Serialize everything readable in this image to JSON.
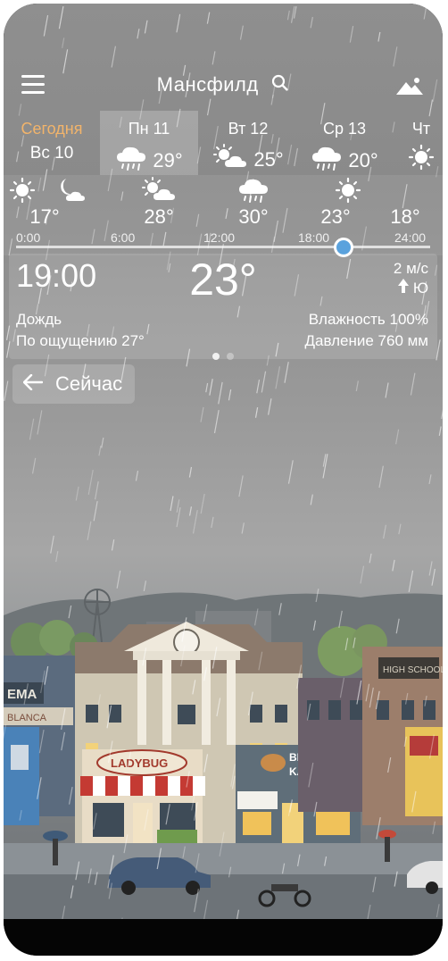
{
  "header": {
    "city": "Мансфилд"
  },
  "days": [
    {
      "name": "Сегодня",
      "date": "Вс 10",
      "today": true
    },
    {
      "name": "Пн 11",
      "temp": "29°",
      "icon": "rain-cloud-icon",
      "active": true
    },
    {
      "name": "Вт 12",
      "temp": "25°",
      "icon": "sun-cloud-icon"
    },
    {
      "name": "Ср 13",
      "temp": "20°",
      "icon": "rain-cloud-icon"
    },
    {
      "name": "Чт",
      "icon": "sun-icon"
    }
  ],
  "hourly": [
    {
      "temp": "17°",
      "icon": "moon-cloud-icon"
    },
    {
      "temp": "28°",
      "icon": "sun-cloud-icon"
    },
    {
      "temp": "30°",
      "icon": "rain-cloud-icon"
    },
    {
      "temp": "23°",
      "icon": "sun-icon"
    },
    {
      "temp": "18°",
      "icon": "sun-icon"
    }
  ],
  "ticks": [
    "0:00",
    "6:00",
    "12:00",
    "18:00",
    "24:00"
  ],
  "selected_time_fraction": 0.79,
  "current": {
    "time": "19:00",
    "temp": "23°",
    "wind_speed": "2 м/с",
    "wind_dir": "Ю",
    "condition": "Дождь",
    "feels_like": "По ощущению 27°",
    "humidity": "Влажность 100%",
    "pressure": "Давление 760 мм"
  },
  "page_dots": {
    "count": 2,
    "active": 0
  },
  "now_button": {
    "label": "Сейчас"
  },
  "scene_signs": {
    "cinema": "EMA",
    "cinema_sub": "BLANCA",
    "ladybug": "LADYBUG",
    "kahuna_1": "BIG",
    "kahuna_2": "KAHUNA",
    "school": "HIGH SCHOOL"
  },
  "colors": {
    "today": "#f2b46b",
    "knob": "#5aa2dd"
  }
}
